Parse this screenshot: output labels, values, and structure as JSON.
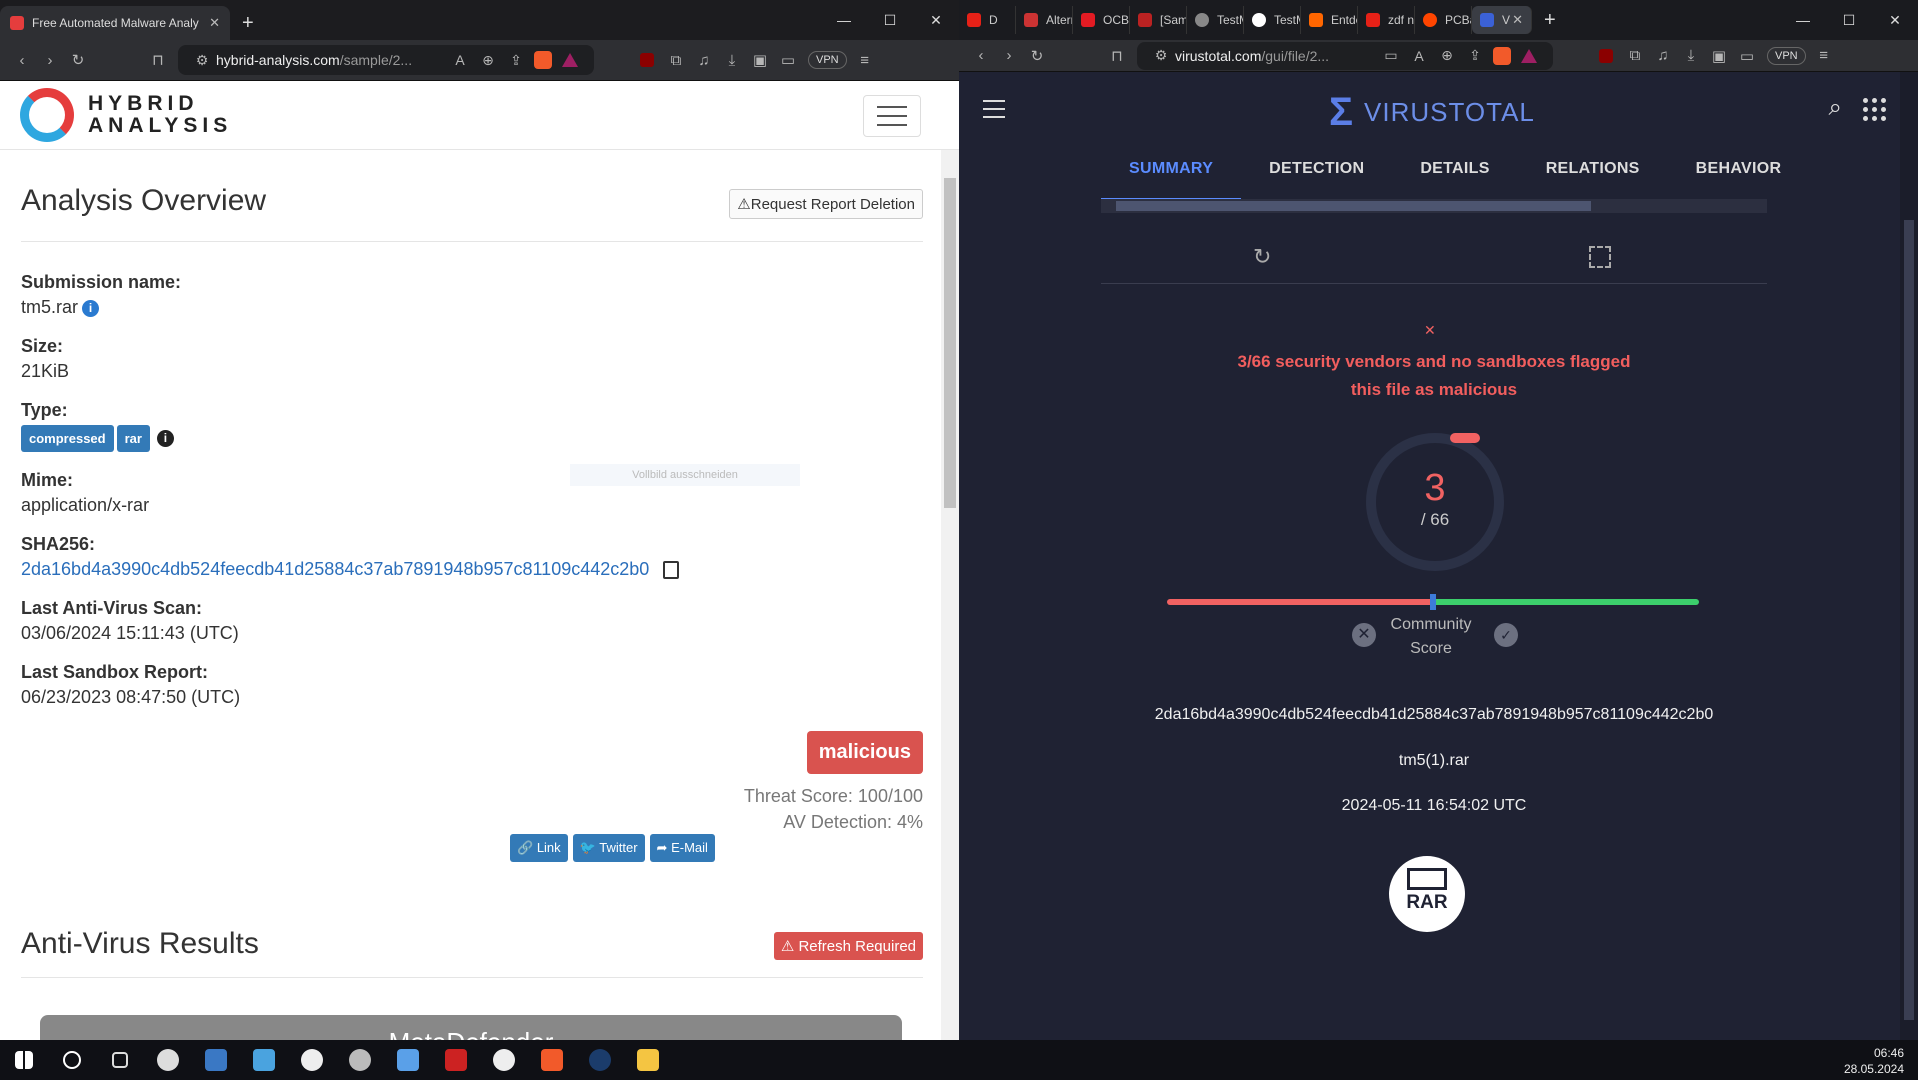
{
  "left_window": {
    "tab_title": "Free Automated Malware Analy",
    "url_host": "hybrid-analysis.com",
    "url_path": "/sample/2...",
    "vpn": "VPN"
  },
  "ha": {
    "brand_line1": "HYBRID",
    "brand_line2": "ANALYSIS",
    "overview_title": "Analysis Overview",
    "request_deletion": "Request Report Deletion",
    "ghost_text": "Vollbild ausschneiden",
    "fields": {
      "submission_label": "Submission name:",
      "submission_value": "tm5.rar",
      "size_label": "Size:",
      "size_value": "21KiB",
      "type_label": "Type:",
      "type_tags": [
        "compressed",
        "rar"
      ],
      "mime_label": "Mime:",
      "mime_value": "application/x-rar",
      "sha_label": "SHA256:",
      "sha_value": "2da16bd4a3990c4db524feecdb41d25884c37ab7891948b957c81109c442c2b0",
      "av_label": "Last Anti-Virus Scan:",
      "av_value": "03/06/2024 15:11:43 (UTC)",
      "sandbox_label": "Last Sandbox Report:",
      "sandbox_value": "06/23/2023 08:47:50 (UTC)"
    },
    "verdict": "malicious",
    "threat_score": "Threat Score: 100/100",
    "av_detection": "AV Detection: 4%",
    "share": [
      "Link",
      "Twitter",
      "E-Mail"
    ],
    "av_results_title": "Anti-Virus Results",
    "refresh_required": "Refresh Required",
    "meta_defender": "MetaDefender"
  },
  "right_window": {
    "tabs": [
      "D",
      "Altern",
      "OCBA",
      "[Sam",
      "TestM",
      "TestM",
      "Entde",
      "zdf n",
      "PCBa",
      "V"
    ],
    "url_host": "virustotal.com",
    "url_path": "/gui/file/2...",
    "vpn": "VPN"
  },
  "vt": {
    "brand": "VIRUSTOTAL",
    "tabs": [
      "SUMMARY",
      "DETECTION",
      "DETAILS",
      "RELATIONS",
      "BEHAVIOR"
    ],
    "flag_message_line1": "3/66 security vendors and no sandboxes flagged",
    "flag_message_line2": "this file as malicious",
    "detections": "3",
    "total": "/ 66",
    "community_label": "Community",
    "score_label": "Score",
    "hash": "2da16bd4a3990c4db524feecdb41d25884c37ab7891948b957c81109c442c2b0",
    "filename": "tm5(1).rar",
    "date": "2024-05-11 16:54:02 UTC",
    "filetype": "RAR",
    "accent": "#5b8cff",
    "alert": "#f16262"
  },
  "taskbar": {
    "time": "06:46",
    "date": "28.05.2024"
  }
}
